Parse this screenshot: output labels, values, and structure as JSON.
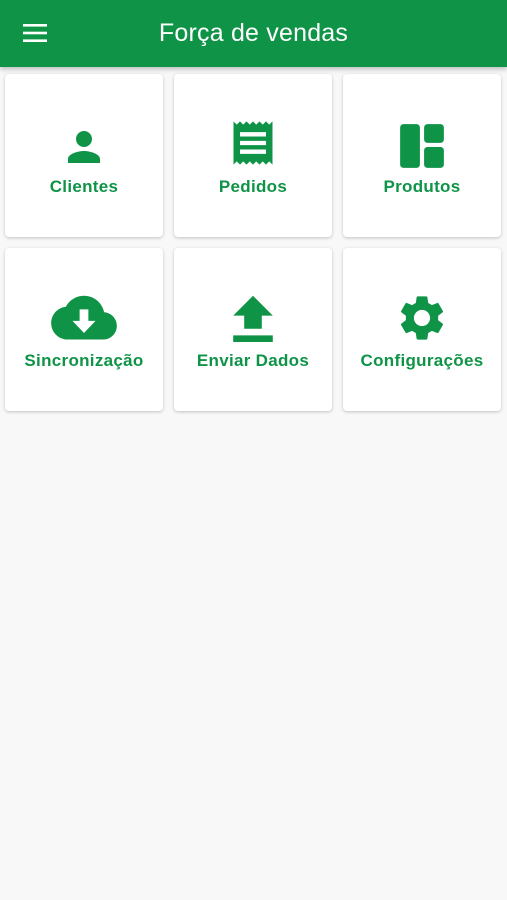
{
  "appbar": {
    "title": "Força de vendas",
    "menu_icon": "menu-icon"
  },
  "colors": {
    "primary": "#0f9447",
    "background": "#f8f8f8",
    "card": "#ffffff"
  },
  "menu": [
    {
      "label": "Clientes",
      "icon": "person-icon"
    },
    {
      "label": "Pedidos",
      "icon": "receipt-icon"
    },
    {
      "label": "Produtos",
      "icon": "dashboard-icon"
    },
    {
      "label": "Sincronização",
      "icon": "cloud-download-icon"
    },
    {
      "label": "Enviar Dados",
      "icon": "upload-icon"
    },
    {
      "label": "Configurações",
      "icon": "gear-icon"
    }
  ]
}
